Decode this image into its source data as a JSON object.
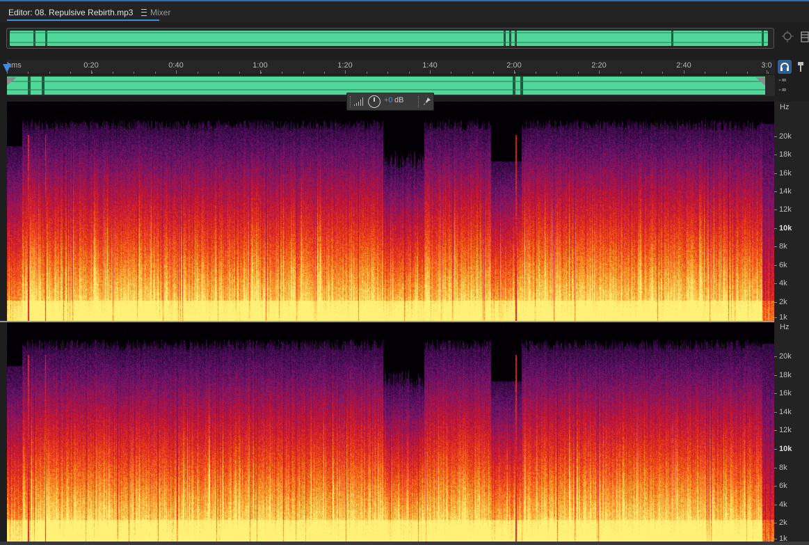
{
  "tabs": {
    "editor_label": "Editor: 08. Repulsive Rebirth.mp3",
    "mixer_label": "Mixer"
  },
  "ruler": {
    "labels": [
      "hms",
      "0:20",
      "0:40",
      "1:00",
      "1:20",
      "1:40",
      "2:00",
      "2:20",
      "2:40",
      "3:0"
    ]
  },
  "levels": {
    "ch1": "-∞",
    "ch2": "-∞"
  },
  "hud": {
    "value": "+0",
    "unit": "dB"
  },
  "hz": {
    "unit": "Hz",
    "labels": [
      "20k",
      "18k",
      "16k",
      "14k",
      "12k",
      "10k",
      "8k",
      "6k",
      "4k",
      "2k",
      "1k"
    ],
    "bold_label": "10k"
  },
  "colors": {
    "accent": "#3f8be0",
    "waveform": "#4fd89a",
    "spectral_low": "#000000",
    "spectral_mid": "#c0102b",
    "spectral_high": "#ffe45a"
  },
  "icons": [
    "menu-icon",
    "zoom-icon",
    "panel-icon",
    "headphones-icon",
    "pin-icon",
    "level-meter-icon",
    "knob-icon",
    "pushpin-icon"
  ]
}
